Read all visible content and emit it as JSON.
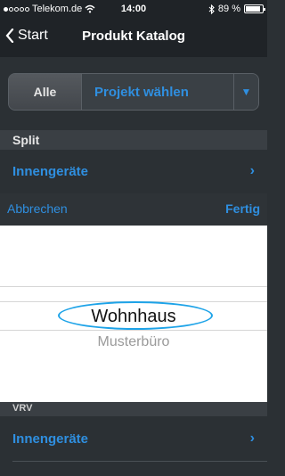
{
  "status_bar": {
    "carrier": "Telekom.de",
    "time": "14:00",
    "battery": "89 %",
    "battery_level": 0.89,
    "icons": [
      "signal-dots-icon",
      "wifi-icon",
      "bluetooth-icon",
      "battery-icon"
    ]
  },
  "nav": {
    "back_label": "Start",
    "title": "Produkt Katalog"
  },
  "filter": {
    "all_label": "Alle",
    "project_placeholder": "Projekt wählen"
  },
  "sections": [
    {
      "header": "Split",
      "row": "Innengeräte"
    },
    {
      "header": "VRV",
      "row": "Innengeräte"
    }
  ],
  "picker": {
    "cancel_label": "Abbrechen",
    "done_label": "Fertig",
    "selected": "Wohnhaus",
    "next": "Musterbüro"
  },
  "colors": {
    "accent": "#2f8fe0",
    "highlight_ring": "#1da3e8",
    "background": "#2b3034"
  }
}
